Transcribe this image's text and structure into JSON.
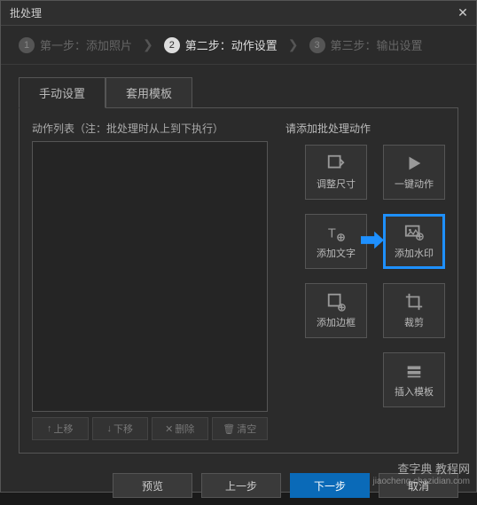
{
  "titlebar": {
    "title": "批处理"
  },
  "steps": {
    "s1": {
      "num": "1",
      "label": "第一步：添加照片"
    },
    "s2": {
      "num": "2",
      "label": "第二步：动作设置"
    },
    "s3": {
      "num": "3",
      "label": "第三步：输出设置"
    }
  },
  "tabs": {
    "manual": "手动设置",
    "template": "套用模板"
  },
  "left": {
    "label": "动作列表（注：批处理时从上到下执行）"
  },
  "listbtns": {
    "up": "上移",
    "down": "下移",
    "del": "删除",
    "clear": "清空"
  },
  "right": {
    "label": "请添加批处理动作"
  },
  "actions": {
    "resize": "调整尺寸",
    "oneclick": "一键动作",
    "addtext": "添加文字",
    "addwm": "添加水印",
    "addborder": "添加边框",
    "crop": "裁剪",
    "insert": "插入模板"
  },
  "footer": {
    "preview": "预览",
    "prev": "上一步",
    "next": "下一步",
    "cancel": "取消"
  },
  "watermark": {
    "main": "查字典 教程网",
    "sub": "jiaocheng.chazidian.com"
  }
}
